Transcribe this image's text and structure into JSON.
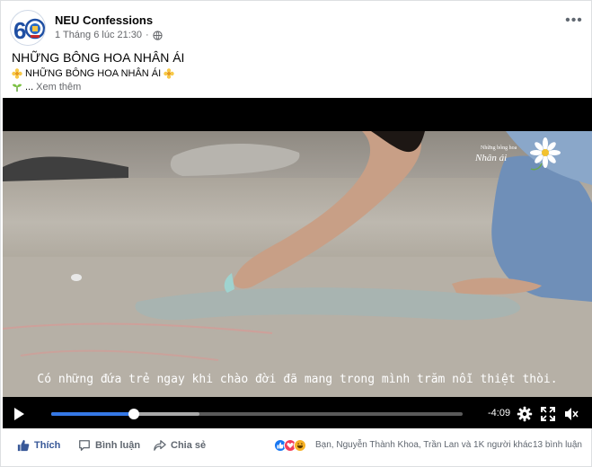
{
  "post": {
    "page_name": "NEU Confessions",
    "timestamp": "1 Tháng 6 lúc 21:30",
    "separator": "·",
    "title": "NHỮNG BÔNG HOA NHÂN ÁI",
    "subtitle_text": "NHỮNG BÔNG HOA NHÂN ÁI",
    "ellipsis": "...",
    "see_more": "Xem thêm",
    "more_icon_text": "•••"
  },
  "video": {
    "caption": "Có những đứa trẻ ngay khi chào đời đã mang trong mình trăm nỗi thiệt thòi.",
    "watermark_text": "Những bông hoa",
    "watermark_script": "Nhân ái",
    "time_remaining": "-4:09",
    "progress": 0.2
  },
  "actions": {
    "like": "Thích",
    "comment": "Bình luận",
    "share": "Chia sẻ"
  },
  "reactions": {
    "summary": "Bạn, Nguyễn Thành Khoa, Trần Lan và 1K người khác",
    "comments_count": "13 bình luận",
    "types": [
      "like",
      "love",
      "haha"
    ]
  },
  "colors": {
    "link_blue": "#385898",
    "progress_blue": "#3578e5",
    "like_blue": "#1877f2",
    "love_red": "#f33e58",
    "haha_yellow": "#f7b125"
  }
}
